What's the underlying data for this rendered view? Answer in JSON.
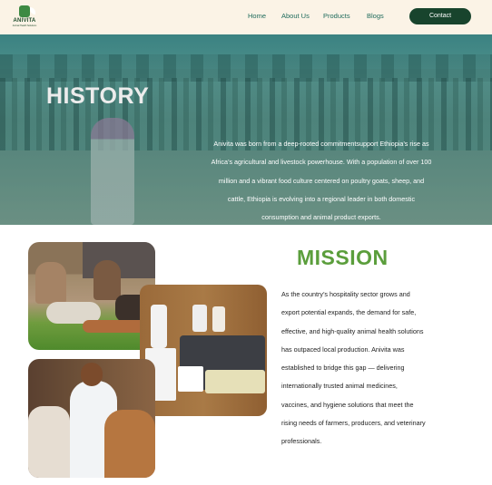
{
  "brand": {
    "name": "ANIVITA",
    "tagline": "Animal Health Solutions"
  },
  "nav": {
    "links": [
      "Home",
      "About Us",
      "Products",
      "Blogs"
    ],
    "contact_label": "Contact"
  },
  "history": {
    "title": "HISTORY",
    "lines": [
      "Anivita was born from a deep-rooted commitmentsupport Ethiopia’s  rise as",
      "Africa’s agricultural and livestock powerhouse. With a  population of over 100",
      "million and a vibrant food culture centered on  poultry goats, sheep, and",
      "cattle, Ethiopia is evolving into a regional leader in both domestic",
      "consumption and animal product exports."
    ]
  },
  "mission": {
    "title": "MISSION",
    "lines": [
      "As the country’s hospitality sector grows and",
      " export potential expands, the demand for safe,",
      "effective, and high-quality animal health solutions",
      " has outpaced local production. Anivita was",
      "established to bridge this gap — delivering",
      "internationally trusted animal medicines,",
      "vaccines, and hygiene solutions that meet the",
      "rising needs of farmers, producers, and veterinary",
      " professionals."
    ]
  },
  "colors": {
    "nav_bg": "#fbf3e6",
    "nav_link": "#1f6b5c",
    "contact_bg": "#18442d",
    "mission_green": "#5b9e3c"
  }
}
